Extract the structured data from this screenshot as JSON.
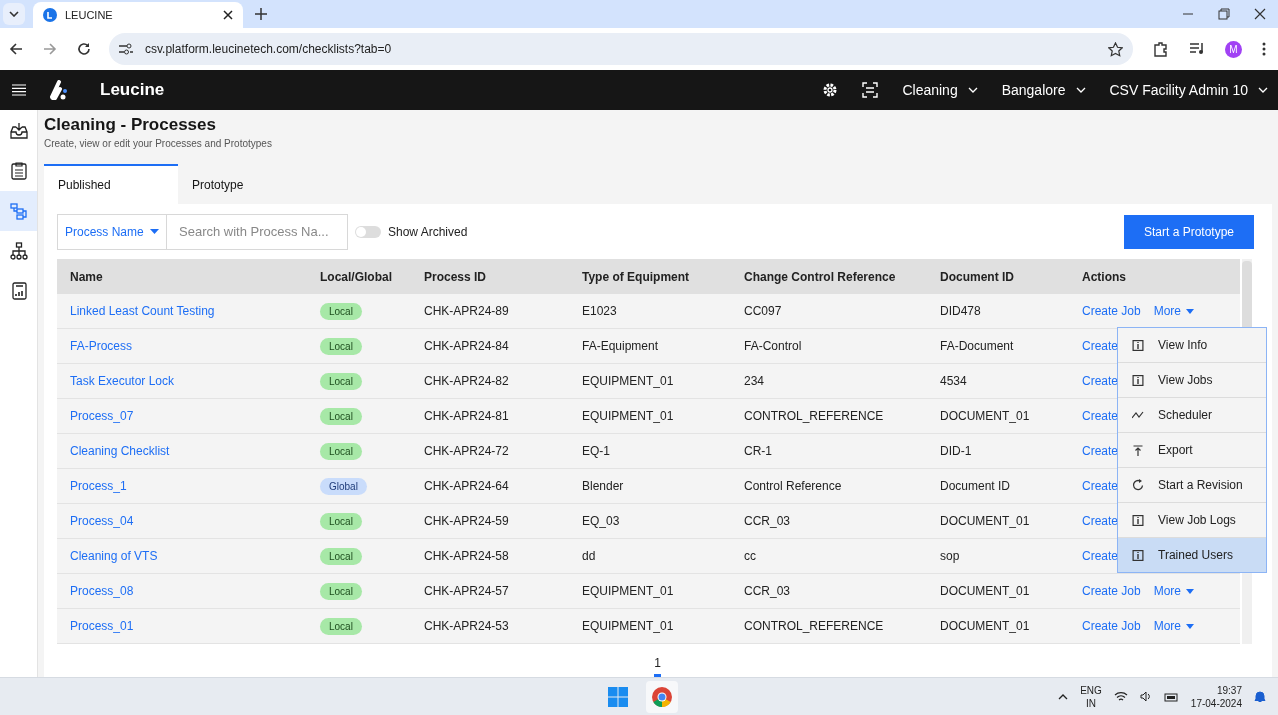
{
  "browser": {
    "tab_title": "LEUCINE",
    "url": "csv.platform.leucinetech.com/checklists?tab=0",
    "avatar_letter": "M"
  },
  "header": {
    "brand": "Leucine",
    "dropdowns": [
      {
        "label": "Cleaning"
      },
      {
        "label": "Bangalore"
      },
      {
        "label": "CSV Facility Admin 10"
      }
    ]
  },
  "sidebar": {
    "items": [
      {
        "kind": "inbox",
        "selected": false
      },
      {
        "kind": "clipboard",
        "selected": false
      },
      {
        "kind": "flow",
        "selected": true
      },
      {
        "kind": "hierarchy",
        "selected": false
      },
      {
        "kind": "report",
        "selected": false
      }
    ]
  },
  "page": {
    "title": "Cleaning - Processes",
    "subtitle": "Create, view or edit your Processes and Prototypes"
  },
  "tabs": [
    {
      "label": "Published",
      "selected": true
    },
    {
      "label": "Prototype",
      "selected": false
    }
  ],
  "filters": {
    "dropdown": "Process Name",
    "search_placeholder": "Search with Process Na...",
    "toggle_label": "Show Archived",
    "toggle_on": false,
    "primary_button": "Start a Prototype"
  },
  "table": {
    "columns": [
      "Name",
      "Local/Global",
      "Process ID",
      "Type of Equipment",
      "Change Control Reference",
      "Document ID",
      "Actions"
    ],
    "rows": [
      {
        "name": "Linked Least Count Testing",
        "scope": "Local",
        "kind": "local",
        "process_id": "CHK-APR24-89",
        "equipment": "E1023",
        "change_control": "CC097",
        "document_id": "DID478",
        "create": "Create Job",
        "more": "More"
      },
      {
        "name": "FA-Process",
        "scope": "Local",
        "kind": "local",
        "process_id": "CHK-APR24-84",
        "equipment": "FA-Equipment",
        "change_control": "FA-Control",
        "document_id": "FA-Document",
        "create": "Create"
      },
      {
        "name": "Task Executor Lock",
        "scope": "Local",
        "kind": "local",
        "process_id": "CHK-APR24-82",
        "equipment": "EQUIPMENT_01",
        "change_control": "234",
        "document_id": "4534",
        "create": "Create"
      },
      {
        "name": "Process_07",
        "scope": "Local",
        "kind": "local",
        "process_id": "CHK-APR24-81",
        "equipment": "EQUIPMENT_01",
        "change_control": "CONTROL_REFERENCE",
        "document_id": "DOCUMENT_01",
        "create": "Create"
      },
      {
        "name": "Cleaning Checklist",
        "scope": "Local",
        "kind": "local",
        "process_id": "CHK-APR24-72",
        "equipment": "EQ-1",
        "change_control": "CR-1",
        "document_id": "DID-1",
        "create": "Create"
      },
      {
        "name": "Process_1",
        "scope": "Global",
        "kind": "global",
        "process_id": "CHK-APR24-64",
        "equipment": "Blender",
        "change_control": "Control Reference",
        "document_id": "Document ID",
        "create": "Create"
      },
      {
        "name": "Process_04",
        "scope": "Local",
        "kind": "local",
        "process_id": "CHK-APR24-59",
        "equipment": "EQ_03",
        "change_control": "CCR_03",
        "document_id": "DOCUMENT_01",
        "create": "Create"
      },
      {
        "name": "Cleaning of VTS",
        "scope": "Local",
        "kind": "local",
        "process_id": "CHK-APR24-58",
        "equipment": "dd",
        "change_control": "cc",
        "document_id": "sop",
        "create": "Create"
      },
      {
        "name": "Process_08",
        "scope": "Local",
        "kind": "local",
        "process_id": "CHK-APR24-57",
        "equipment": "EQUIPMENT_01",
        "change_control": "CCR_03",
        "document_id": "DOCUMENT_01",
        "create": "Create Job",
        "more": "More"
      },
      {
        "name": "Process_01",
        "scope": "Local",
        "kind": "local",
        "process_id": "CHK-APR24-53",
        "equipment": "EQUIPMENT_01",
        "change_control": "CONTROL_REFERENCE",
        "document_id": "DOCUMENT_01",
        "create": "Create Job",
        "more": "More"
      }
    ]
  },
  "more_menu": {
    "items": [
      {
        "label": "View Info",
        "kind": "info",
        "selected": false
      },
      {
        "label": "View Jobs",
        "kind": "info",
        "selected": false
      },
      {
        "label": "Scheduler",
        "kind": "trend",
        "selected": false
      },
      {
        "label": "Export",
        "kind": "export",
        "selected": false
      },
      {
        "label": "Start a Revision",
        "kind": "revision",
        "selected": false
      },
      {
        "label": "View Job Logs",
        "kind": "info",
        "selected": false
      },
      {
        "label": "Trained Users",
        "kind": "info",
        "selected": true
      }
    ]
  },
  "pagination": [
    {
      "label": "1",
      "selected": true
    }
  ],
  "taskbar": {
    "language": "ENG",
    "region": "IN",
    "time": "19:37",
    "date": "17-04-2024"
  }
}
